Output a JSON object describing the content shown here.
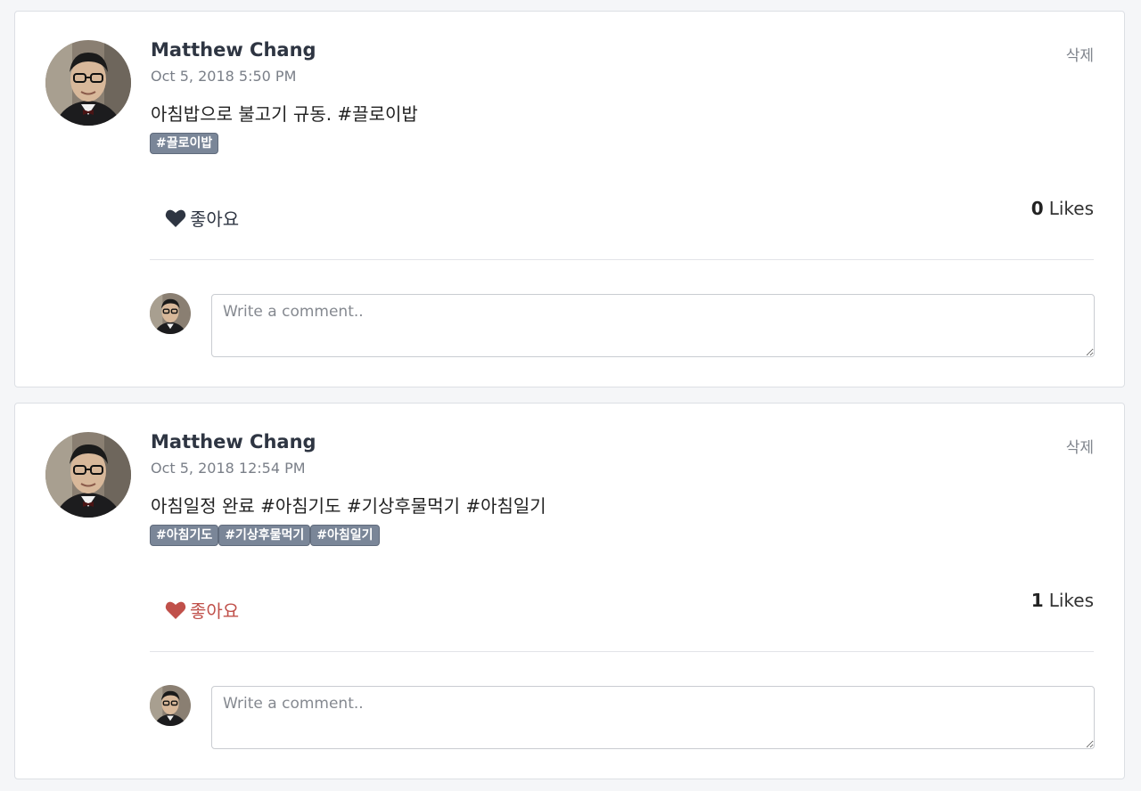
{
  "posts": [
    {
      "author": "Matthew Chang",
      "date": "Oct 5, 2018 5:50 PM",
      "delete_label": "삭제",
      "content": "아침밥으로 불고기 규동. #끌로이밥",
      "tags": [
        "#끌로이밥"
      ],
      "like_label": "좋아요",
      "liked": false,
      "like_color": "#2e3542",
      "likes_count": "0",
      "likes_word": "Likes",
      "comment_placeholder": "Write a comment.."
    },
    {
      "author": "Matthew Chang",
      "date": "Oct 5, 2018 12:54 PM",
      "delete_label": "삭제",
      "content": "아침일정 완료 #아침기도 #기상후물먹기 #아침일기",
      "tags": [
        "#아침기도",
        "#기상후물먹기",
        "#아침일기"
      ],
      "like_label": "좋아요",
      "liked": true,
      "like_color": "#c0504a",
      "likes_count": "1",
      "likes_word": "Likes",
      "comment_placeholder": "Write a comment.."
    }
  ],
  "colors": {
    "tag_bg": "#7a8698",
    "liked": "#c0504a",
    "unliked": "#2e3542"
  }
}
